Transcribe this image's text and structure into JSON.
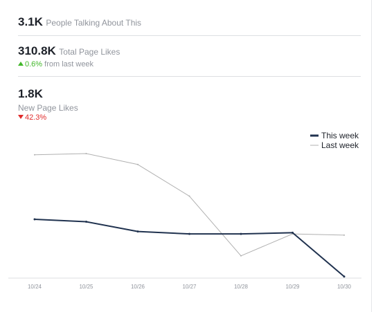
{
  "stats": {
    "talking": {
      "value": "3.1K",
      "label": "People Talking About This"
    },
    "page_likes": {
      "value": "310.8K",
      "label": "Total Page Likes",
      "change": "0.6%",
      "change_suffix": "from last week",
      "direction": "up"
    },
    "new_likes": {
      "value": "1.8K",
      "label": "New Page Likes",
      "change": "42.3%",
      "direction": "down"
    }
  },
  "colors": {
    "this_week": "#20324f",
    "last_week": "#b0b0b0",
    "up": "#42b72a",
    "down": "#e02b2b"
  },
  "chart_data": {
    "type": "line",
    "categories": [
      "10/24",
      "10/25",
      "10/26",
      "10/27",
      "10/28",
      "10/29",
      "10/30"
    ],
    "series": [
      {
        "name": "This week",
        "values": [
          50,
          48,
          40,
          38,
          38,
          39,
          3
        ]
      },
      {
        "name": "Last week",
        "values": [
          103,
          104,
          95,
          69,
          20,
          38,
          37
        ]
      }
    ],
    "ylim": [
      0,
      125
    ],
    "legend": "top-right",
    "grid": false
  }
}
